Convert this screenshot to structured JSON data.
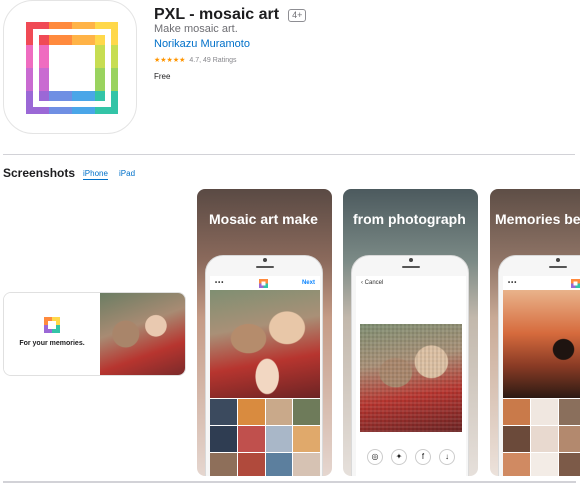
{
  "app": {
    "title": "PXL - mosaic art",
    "age_rating": "4+",
    "subtitle": "Make mosaic art.",
    "developer": "Norikazu Muramoto",
    "stars": "★★★★★",
    "rating_text": "4.7, 49 Ratings",
    "price": "Free"
  },
  "screenshots": {
    "title": "Screenshots",
    "tabs": [
      {
        "label": "iPhone",
        "active": true
      },
      {
        "label": "iPad",
        "active": false
      }
    ],
    "items": [
      {
        "tagline": "For your memories."
      },
      {
        "heading": "Mosaic art make",
        "nav_left": "•••",
        "nav_right": "Next"
      },
      {
        "heading": "from photograph",
        "nav_left": "‹ Cancel"
      },
      {
        "heading": "Memories be",
        "nav_left": "•••"
      }
    ]
  },
  "colors": {
    "link_blue": "#0070c9",
    "star_orange": "#ff9500",
    "logo": [
      "#f04a55",
      "#ff8a3d",
      "#ffd84a",
      "#9ad35f",
      "#33c4a7",
      "#4aa6e8",
      "#9b68d6",
      "#ef6cc0"
    ]
  }
}
